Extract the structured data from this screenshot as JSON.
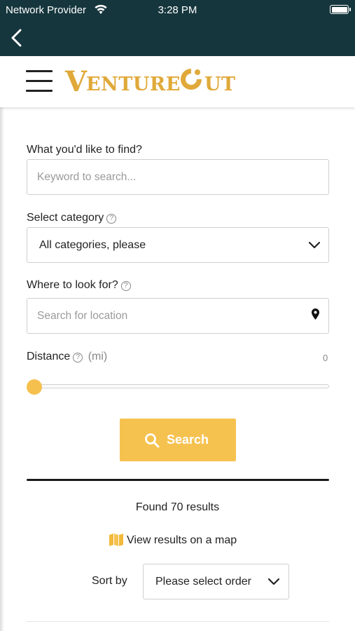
{
  "status_bar": {
    "carrier": "Network Provider",
    "time": "3:28 PM"
  },
  "nav": {
    "back_icon": "chevron-left-icon"
  },
  "header": {
    "menu_icon": "hamburger-menu-icon",
    "logo_text": "VENTURE OUT",
    "logo_color": "#e0a93a"
  },
  "search_form": {
    "keyword": {
      "label": "What you'd like to find?",
      "placeholder": "Keyword to search..."
    },
    "category": {
      "label": "Select category",
      "help_icon": "?",
      "selected": "All categories, please"
    },
    "location": {
      "label": "Where to look for?",
      "help_icon": "?",
      "placeholder": "Search for location"
    },
    "distance": {
      "label": "Distance",
      "help_icon": "?",
      "unit": "(mi)",
      "value": "0"
    },
    "search_button": "Search",
    "accent_color": "#f6c24f"
  },
  "results": {
    "count_text": "Found 70 results",
    "map_link": "View results on a map",
    "sort_label": "Sort by",
    "sort_selected": "Please select order"
  },
  "colors": {
    "nav_background": "#15363d"
  }
}
